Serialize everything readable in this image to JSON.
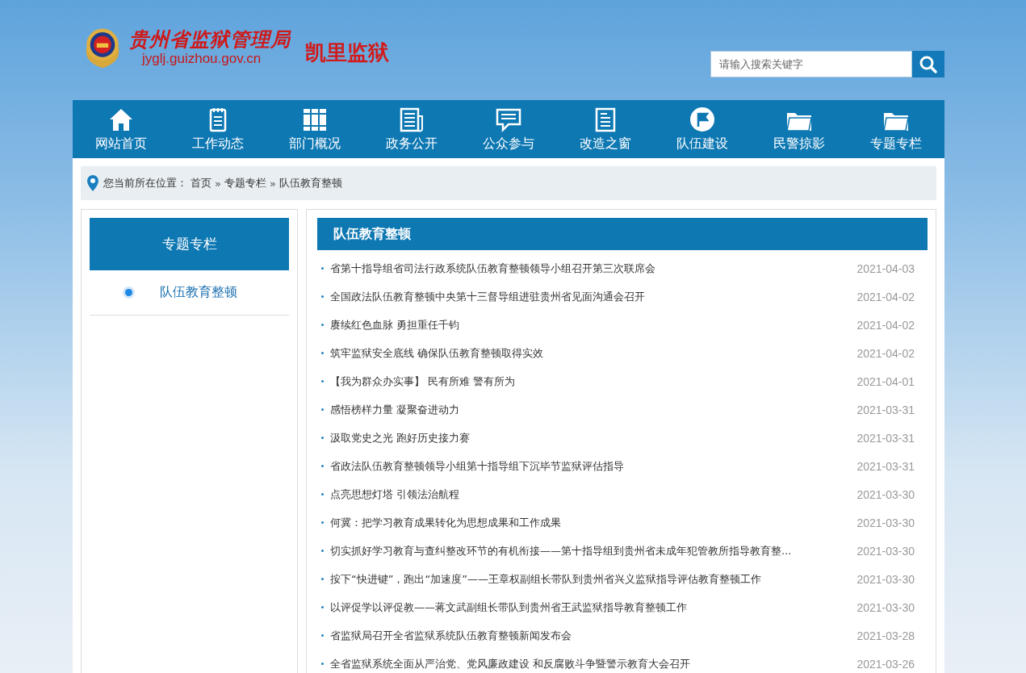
{
  "header": {
    "agency": "贵州省监狱管理局",
    "url": "jyglj.guizhou.gov.cn",
    "site_name": "凯里监狱",
    "search": {
      "placeholder": "请输入搜索关键字"
    }
  },
  "nav": [
    {
      "label": "网站首页",
      "kind": "home"
    },
    {
      "label": "工作动态",
      "kind": "notepad"
    },
    {
      "label": "部门概况",
      "kind": "books"
    },
    {
      "label": "政务公开",
      "kind": "newspaper"
    },
    {
      "label": "公众参与",
      "kind": "chat"
    },
    {
      "label": "改造之窗",
      "kind": "document"
    },
    {
      "label": "队伍建设",
      "kind": "flag"
    },
    {
      "label": "民警掠影",
      "kind": "folder"
    },
    {
      "label": "专题专栏",
      "kind": "folder"
    }
  ],
  "breadcrumb": {
    "prefix": "您当前所在位置：",
    "items": [
      {
        "label": "首页"
      },
      {
        "label": "»",
        "kind": "sep"
      },
      {
        "label": "专题专栏"
      },
      {
        "label": "»",
        "kind": "sep"
      },
      {
        "label": "队伍教育整顿"
      }
    ]
  },
  "sidebar": {
    "title": "专题专栏",
    "items": [
      {
        "label": "队伍教育整顿",
        "selected": true
      }
    ]
  },
  "list": {
    "title": "队伍教育整顿",
    "items": [
      {
        "title": "省第十指导组省司法行政系统队伍教育整顿领导小组召开第三次联席会",
        "date": "2021-04-03"
      },
      {
        "title": "全国政法队伍教育整顿中央第十三督导组进驻贵州省见面沟通会召开",
        "date": "2021-04-02"
      },
      {
        "title": "赓续红色血脉 勇担重任千钧",
        "date": "2021-04-02"
      },
      {
        "title": "筑牢监狱安全底线 确保队伍教育整顿取得实效",
        "date": "2021-04-02"
      },
      {
        "title": "【我为群众办实事】 民有所难 警有所为",
        "date": "2021-04-01"
      },
      {
        "title": "感悟榜样力量 凝聚奋进动力",
        "date": "2021-03-31"
      },
      {
        "title": "汲取党史之光 跑好历史接力赛",
        "date": "2021-03-31"
      },
      {
        "title": "省政法队伍教育整顿领导小组第十指导组下沉毕节监狱评估指导",
        "date": "2021-03-31"
      },
      {
        "title": "点亮思想灯塔 引领法治航程",
        "date": "2021-03-30"
      },
      {
        "title": "何冀：把学习教育成果转化为思想成果和工作成果",
        "date": "2021-03-30"
      },
      {
        "title": "切实抓好学习教育与查纠整改环节的有机衔接——第十指导组到贵州省未成年犯管教所指导教育整...",
        "date": "2021-03-30"
      },
      {
        "title": "按下“快进键”，跑出“加速度”——王章权副组长带队到贵州省兴义监狱指导评估教育整顿工作",
        "date": "2021-03-30"
      },
      {
        "title": "以评促学以评促教——蒋文武副组长带队到贵州省王武监狱指导教育整顿工作",
        "date": "2021-03-30"
      },
      {
        "title": "省监狱局召开全省监狱系统队伍教育整顿新闻发布会",
        "date": "2021-03-28"
      },
      {
        "title": "全省监狱系统全面从严治党、党风廉政建设 和反腐败斗争暨警示教育大会召开",
        "date": "2021-03-26"
      }
    ]
  }
}
